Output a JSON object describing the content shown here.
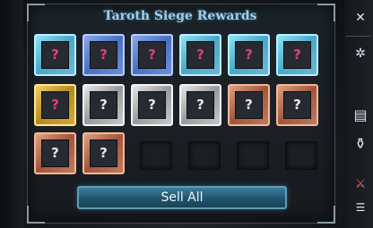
{
  "dialog": {
    "title": "Taroth Siege Rewards",
    "mystery_glyph": "?"
  },
  "rewards": [
    {
      "rarity": "cyan",
      "icon": "question-mark-icon"
    },
    {
      "rarity": "blue",
      "icon": "question-mark-icon"
    },
    {
      "rarity": "blue",
      "icon": "question-mark-icon"
    },
    {
      "rarity": "cyan",
      "icon": "question-mark-icon"
    },
    {
      "rarity": "cyan",
      "icon": "question-mark-icon"
    },
    {
      "rarity": "cyan",
      "icon": "question-mark-icon"
    },
    {
      "rarity": "gold",
      "icon": "question-mark-icon"
    },
    {
      "rarity": "silver",
      "icon": "question-mark-icon"
    },
    {
      "rarity": "silver",
      "icon": "question-mark-icon"
    },
    {
      "rarity": "silver",
      "icon": "question-mark-icon"
    },
    {
      "rarity": "bronze",
      "icon": "question-mark-icon"
    },
    {
      "rarity": "bronze",
      "icon": "question-mark-icon"
    },
    {
      "rarity": "bronze",
      "icon": "question-mark-icon"
    },
    {
      "rarity": "bronze",
      "icon": "question-mark-icon"
    }
  ],
  "empty_slots": 4,
  "actions": {
    "sell_all_label": "Sell All"
  },
  "side_rail": {
    "icons": [
      "close-icon",
      "gear-icon",
      "scroll-icon",
      "potion-icon",
      "crossed-swords-icon"
    ]
  },
  "colors": {
    "cyan": "#8fe3f2",
    "blue": "#6f8fd8",
    "gold": "#d7aa34",
    "silver": "#c8c8c8",
    "bronze": "#c27a5c",
    "title": "#9fd0ea",
    "button": "#2a6a86"
  }
}
